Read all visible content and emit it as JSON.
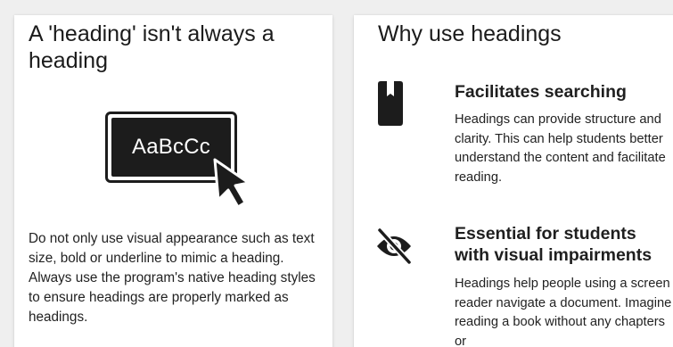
{
  "left_card": {
    "title": "A 'heading' isn't always a heading",
    "illustration_label": "AaBcCc",
    "body": "Do not only use visual appearance such as text size, bold or underline to mimic a heading. Always use the program's native heading styles to ensure headings are properly marked as headings."
  },
  "right_card": {
    "title": "Why use headings",
    "features": [
      {
        "icon": "bookmark-icon",
        "title": "Facilitates searching",
        "text": "Headings can provide structure and clarity. This can help students better understand the content and facilitate reading."
      },
      {
        "icon": "eye-slash-icon",
        "title": "Essential for students with visual impairments",
        "text": "Headings help people using a screen reader navigate a document. Imagine reading a book without any chapters or"
      }
    ]
  },
  "colors": {
    "background": "#efefef",
    "card": "#ffffff",
    "ink": "#1c1c1c"
  }
}
